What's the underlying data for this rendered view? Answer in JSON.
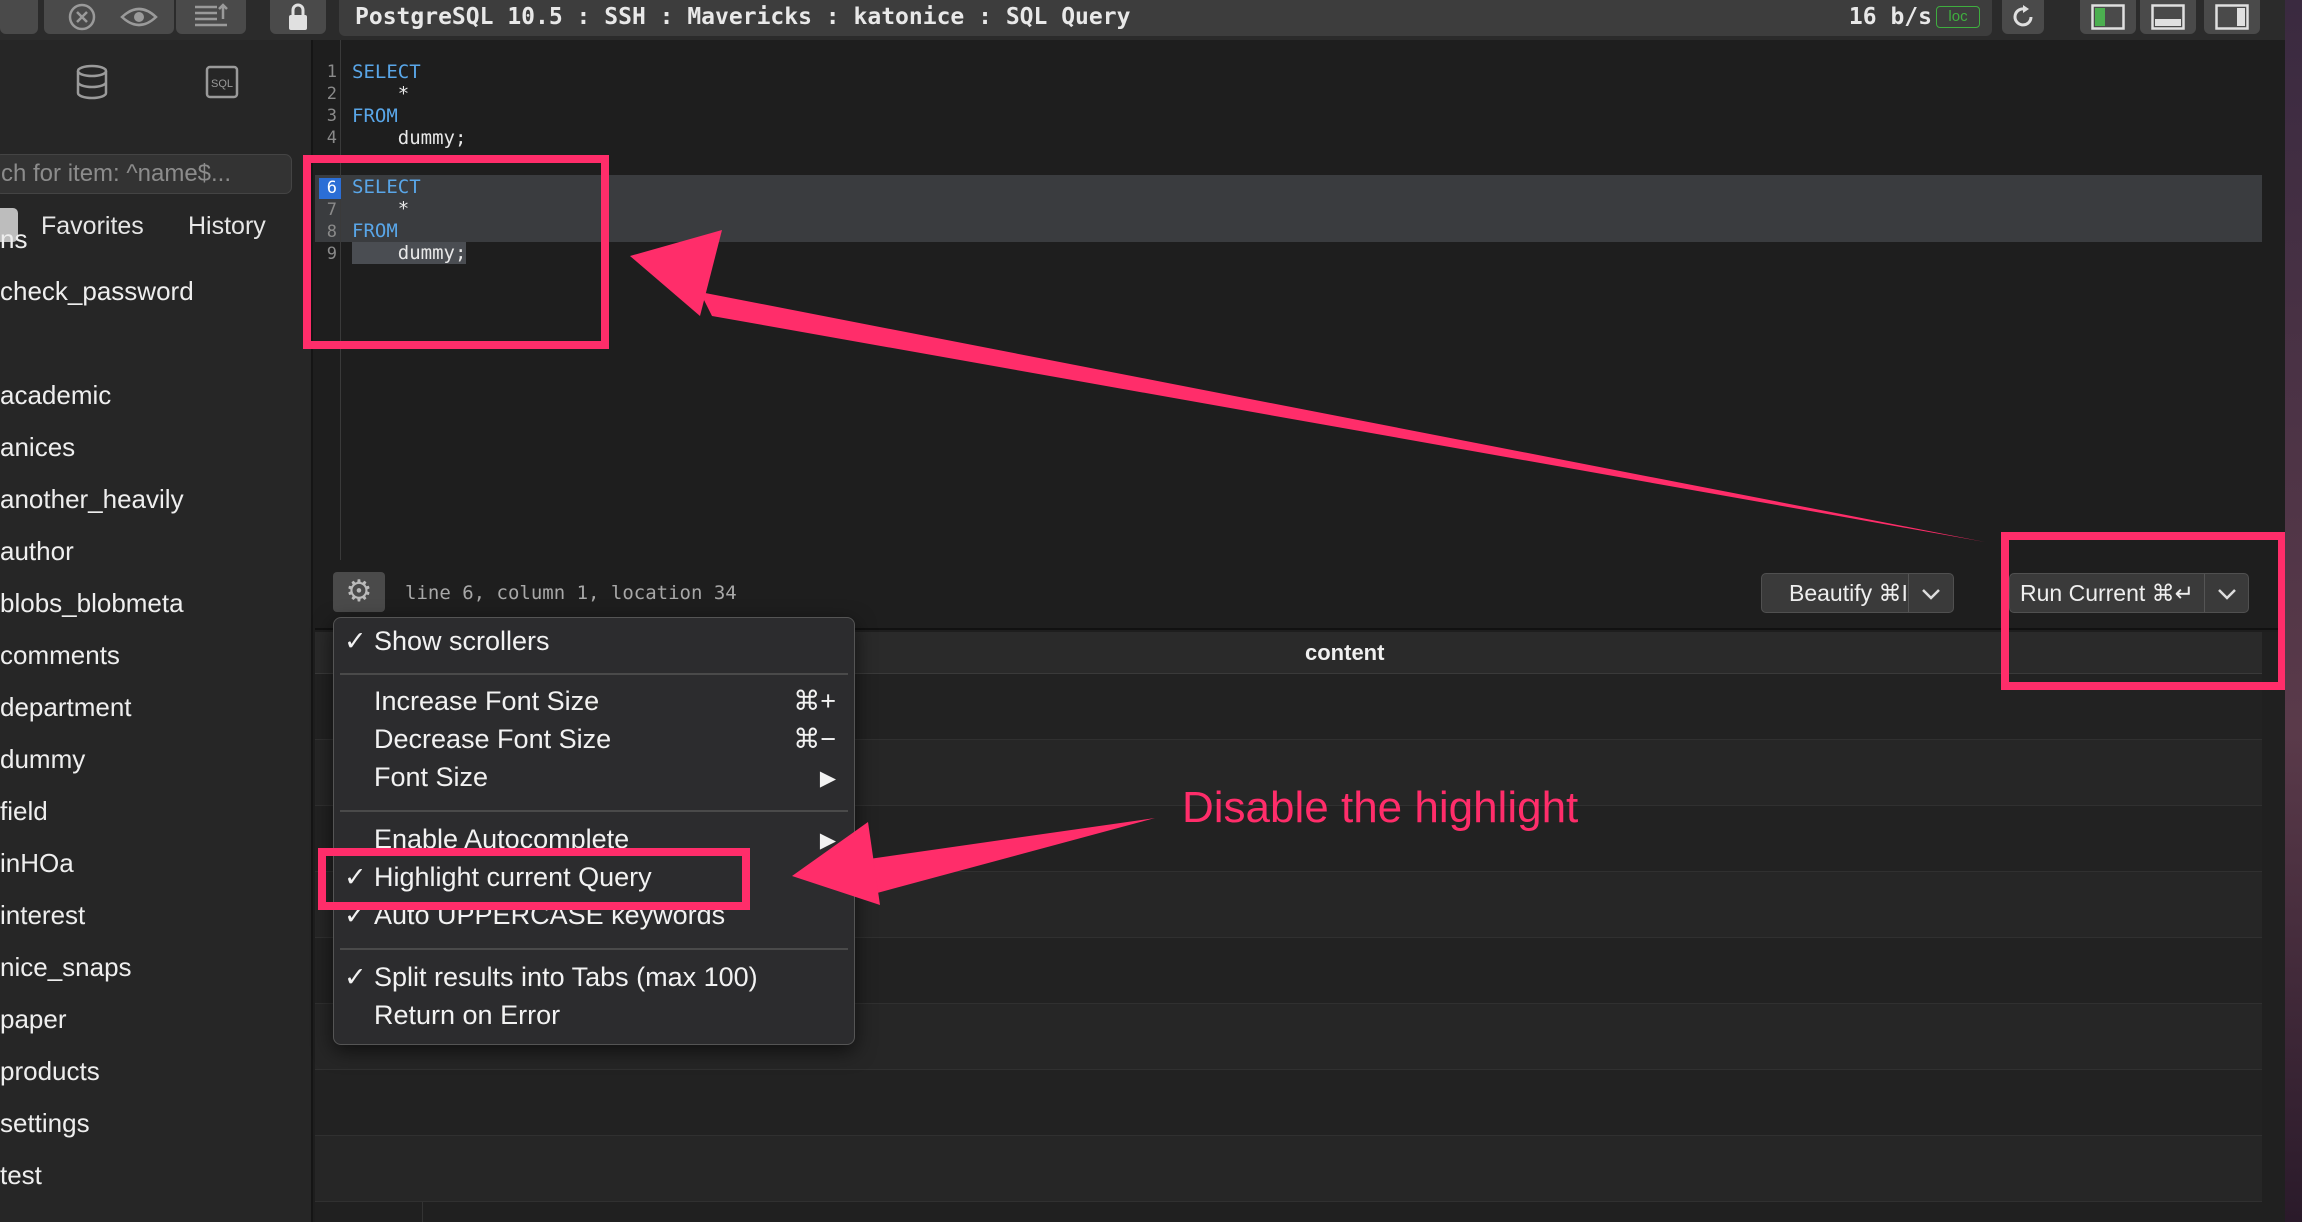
{
  "toolbar": {
    "title": "PostgreSQL 10.5 : SSH : Mavericks : katonice : SQL Query",
    "speed": "16 b/s",
    "loc_badge": "loc"
  },
  "sidebar": {
    "search_placeholder": "ch for item: ^name$...",
    "tabs": [
      "Favorites",
      "History"
    ],
    "items": [
      "ns",
      "check_password",
      "academic",
      "anices",
      "another_heavily",
      "author",
      "blobs_blobmeta",
      "comments",
      "department",
      "dummy",
      "field",
      "inHOa",
      "interest",
      "nice_snaps",
      "paper",
      "products",
      "settings",
      "test"
    ]
  },
  "editor": {
    "line_numbers": [
      "1",
      "2",
      "3",
      "4",
      "6",
      "7",
      "8",
      "9"
    ],
    "lines": [
      {
        "text": "SELECT",
        "kind": "keyword"
      },
      {
        "text": "    *",
        "kind": "text"
      },
      {
        "text": "FROM",
        "kind": "keyword"
      },
      {
        "text": "    dummy;",
        "kind": "text"
      },
      {
        "text": "SELECT",
        "kind": "keyword"
      },
      {
        "text": "    *",
        "kind": "text"
      },
      {
        "text": "FROM",
        "kind": "keyword"
      },
      {
        "text": "    dummy;",
        "kind": "text"
      }
    ],
    "status": "line 6, column 1, location 34"
  },
  "buttons": {
    "beautify": "Beautify ⌘I",
    "run_current": "Run Current ⌘↵"
  },
  "results": {
    "column": "content"
  },
  "menu": {
    "items": [
      {
        "label": "Show scrollers",
        "checked": "✓",
        "shortcut": ""
      },
      {
        "label": "Increase Font Size",
        "checked": "",
        "shortcut": "⌘+"
      },
      {
        "label": "Decrease Font Size",
        "checked": "",
        "shortcut": "⌘−"
      },
      {
        "label": "Font Size",
        "checked": "",
        "shortcut": "▶"
      },
      {
        "label": "Enable Autocomplete",
        "checked": "",
        "shortcut": "▶"
      },
      {
        "label": "Highlight current Query",
        "checked": "✓",
        "shortcut": ""
      },
      {
        "label": "Auto UPPERCASE keywords",
        "checked": "✓",
        "shortcut": ""
      },
      {
        "label": "Split results into Tabs (max 100)",
        "checked": "✓",
        "shortcut": ""
      },
      {
        "label": "Return on Error",
        "checked": "",
        "shortcut": ""
      }
    ]
  },
  "annotation": {
    "text": "Disable the highlight",
    "color": "#ff2d6a"
  },
  "colors": {
    "keyword": "#59a6e8",
    "accent": "#ff2d6a"
  }
}
